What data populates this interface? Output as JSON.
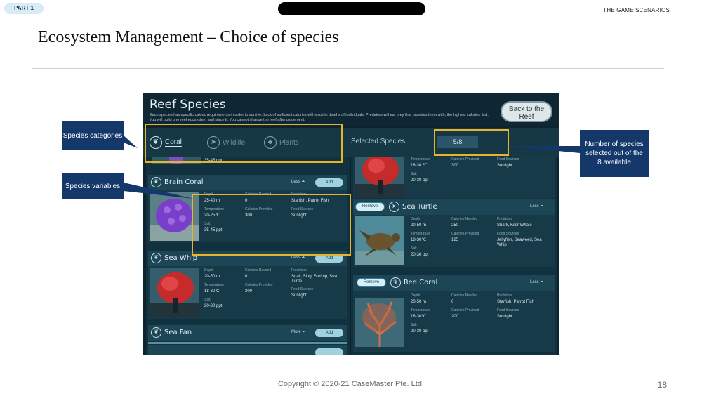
{
  "slide": {
    "part_label": "PART 1",
    "section": "THE GAME SCENARIOS",
    "title": "Ecosystem Management – Choice of species",
    "copyright": "Copyright © 2020-21 CaseMaster Pte. Ltd.",
    "page_number": "18"
  },
  "game": {
    "title": "Reef Species",
    "description": "Each species has specific caloric requirements in order to survive. Lack of sufficient calories will result in deaths of individuals. Predators will eat prey that provides them with, the highest calories first. You will build one reef ecosystem and place it. You cannot change the reef after placement.",
    "back_button": "Back to the Reef",
    "tabs": [
      {
        "label": "Coral",
        "icon": "coral-icon",
        "active": true
      },
      {
        "label": "Wildlife",
        "icon": "fish-icon",
        "active": false
      },
      {
        "label": "Plants",
        "icon": "plant-icon",
        "active": false
      }
    ],
    "selected_label": "Selected Species",
    "selected_count": "5/8",
    "labels": {
      "depth": "Depth",
      "temperature": "Temperature",
      "salt": "Salt",
      "calories_needed": "Calories Needed",
      "calories_provided": "Calories Provided",
      "predators": "Predators",
      "food_sources": "Food Sources",
      "less": "Less",
      "more": "More",
      "add": "Add",
      "remove": "Remove"
    },
    "left_list": {
      "partial_salt": "35-45 ppt",
      "cards": [
        {
          "name": "Brain Coral",
          "depth": "25-40 m",
          "temperature": "20-25℃",
          "salt": "35-45 ppt",
          "calories_needed": "0",
          "calories_provided": "300",
          "predators": "Starfish, Parrot Fish",
          "food_sources": "Sunlight"
        },
        {
          "name": "Sea Whip",
          "depth": "20-50 m",
          "temperature": "18-30 C",
          "salt": "20-30 ppt",
          "calories_needed": "0",
          "calories_provided": "300",
          "predators": "Snail, Slug, Shrimp, Sea Turtle",
          "food_sources": "Sunlight"
        },
        {
          "name": "Sea Fan"
        }
      ]
    },
    "right_list": {
      "partial": {
        "temperature": "18-30 ℃",
        "salt": "20-30 ppt",
        "calories_provided": "300",
        "food_sources": "Sunlight"
      },
      "cards": [
        {
          "name": "Sea Turtle",
          "depth": "20-50 m",
          "temperature": "18-30℃",
          "salt": "20-30 ppt",
          "calories_needed": "250",
          "calories_provided": "125",
          "predators": "Shark, Kiler Whale",
          "food_sources": "Jellyfish, Seaweed, Sea Whip"
        },
        {
          "name": "Red Coral",
          "depth": "20-50 m",
          "temperature": "18-30℃",
          "salt": "20-30 ppt",
          "calories_needed": "0",
          "calories_provided": "200",
          "predators": "Starfish, Parrot Fish",
          "food_sources": "Sunlight"
        }
      ]
    }
  },
  "callouts": {
    "categories": "Species categories",
    "variables": "Species variables",
    "count": "Number of species selected out of the 8 available"
  },
  "colors": {
    "callout_bg": "#14386a",
    "highlight": "#e9b32a",
    "game_bg": "#0d2330"
  }
}
